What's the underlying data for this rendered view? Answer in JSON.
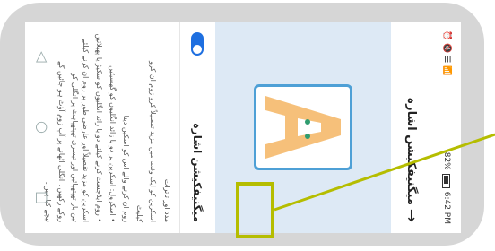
{
  "status": {
    "time": "6:42 PM",
    "battery": "82%",
    "right_icons": "⏰ 🔇 ☰ 📶"
  },
  "appbar": {
    "title": "میگنیفکیشن اشارہ",
    "back_glyph": "→"
  },
  "setting": {
    "title": "میگنیفکیشن اشارہ",
    "enabled": true
  },
  "help": {
    "title": "مدد اور تاثرات",
    "lines": [
      "اسکرین کو ایک وقت میں مزید تفصیلاً کرو زوم ان کرو",
      "کیلیٹ",
      "زوم ان کرنے والے اس کو اسکین دینا",
      "• اسکرول: اسکرین پر دو یا زائد انگلیوں کو گھسیٹیں",
      "• زوم ایڈجسٹ کرنے کیلئے دو یا زائد انگلیوں کو سکیڑ یا پھیلائیں",
      "اسکرین کو مزید تفصیلاً اور عارضی طور پر زوم ان کرنے کیلئے تین بار تھپتھپائیں اور تیسری تھپتھپاہٹ پر انگلی کو",
      "روکے رکھیں۔ انگلی اٹھانے پر آپ زوم آؤٹ ہو جائیں گے",
      "نیچے کیا ہیں۔"
    ]
  },
  "nav": {
    "back": "◁",
    "home": "○",
    "recents": "□"
  },
  "colors": {
    "accent": "#1e6fe0",
    "highlight": "#b5bd00",
    "preview_bg": "#dde9f5",
    "letter": "#f6c07a",
    "frame": "#4ea0d6"
  }
}
